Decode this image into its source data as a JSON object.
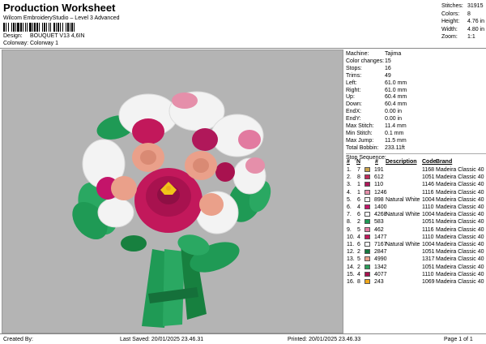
{
  "header": {
    "title": "Production Worksheet",
    "subtitle": "Wilcom EmbroideryStudio – Level 3 Advanced",
    "design_label": "Design:",
    "design_value": "BOUQUET V13 4,6IN",
    "colorway_label": "Colorway:",
    "colorway_value": "Colorway 1",
    "stats": [
      {
        "label": "Stitches:",
        "value": "31915"
      },
      {
        "label": "Colors:",
        "value": "8"
      },
      {
        "label": "Height:",
        "value": "4.76 in"
      },
      {
        "label": "Width:",
        "value": "4.80 in"
      },
      {
        "label": "Zoom:",
        "value": "1:1"
      }
    ]
  },
  "properties": [
    {
      "label": "Machine:",
      "value": "Tajima"
    },
    {
      "label": "Color changes:",
      "value": "15"
    },
    {
      "label": "Stops:",
      "value": "16"
    },
    {
      "label": "Trims:",
      "value": "49"
    },
    {
      "label": "Left:",
      "value": "61.0 mm"
    },
    {
      "label": "Right:",
      "value": "61.0 mm"
    },
    {
      "label": "Up:",
      "value": "60.4 mm"
    },
    {
      "label": "Down:",
      "value": "60.4 mm"
    },
    {
      "label": "EndX:",
      "value": "0.00 in"
    },
    {
      "label": "EndY:",
      "value": "0.00 in"
    },
    {
      "label": "Max Stitch:",
      "value": "11.4 mm"
    },
    {
      "label": "Min Stitch:",
      "value": "0.1 mm"
    },
    {
      "label": "Max Jump:",
      "value": "11.5 mm"
    },
    {
      "label": "Total Bobbin:",
      "value": "233.11ft"
    }
  ],
  "sequence": {
    "title": "Stop Sequence:",
    "headers": {
      "num": "#",
      "n": "N",
      "code_col": "#",
      "description": "Description",
      "code": "Code",
      "brand": "Brand"
    },
    "rows": [
      {
        "num": "1.",
        "n": "7",
        "color": "#c9a24a",
        "code_num": "191",
        "description": "",
        "code": "1168",
        "brand": "Madeira Classic 40"
      },
      {
        "num": "2.",
        "n": "8",
        "color": "#c02a5b",
        "code_num": "612",
        "description": "",
        "code": "1051",
        "brand": "Madeira Classic 40"
      },
      {
        "num": "3.",
        "n": "1",
        "color": "#b0185a",
        "code_num": "110",
        "description": "",
        "code": "1146",
        "brand": "Madeira Classic 40"
      },
      {
        "num": "4.",
        "n": "1",
        "color": "#e58faa",
        "code_num": "1246",
        "description": "",
        "code": "1116",
        "brand": "Madeira Classic 40"
      },
      {
        "num": "5.",
        "n": "6",
        "color": "#f3f3f3",
        "code_num": "898",
        "description": "Natural White",
        "code": "1004",
        "brand": "Madeira Classic 40"
      },
      {
        "num": "6.",
        "n": "4",
        "color": "#c4146a",
        "code_num": "1400",
        "description": "",
        "code": "1110",
        "brand": "Madeira Classic 40"
      },
      {
        "num": "7.",
        "n": "6",
        "color": "#f5f5f5",
        "code_num": "4268",
        "description": "Natural White",
        "code": "1004",
        "brand": "Madeira Classic 40"
      },
      {
        "num": "8.",
        "n": "2",
        "color": "#1f9a55",
        "code_num": "583",
        "description": "",
        "code": "1051",
        "brand": "Madeira Classic 40"
      },
      {
        "num": "9.",
        "n": "5",
        "color": "#e27aa0",
        "code_num": "462",
        "description": "",
        "code": "1116",
        "brand": "Madeira Classic 40"
      },
      {
        "num": "10.",
        "n": "4",
        "color": "#c2185b",
        "code_num": "1477",
        "description": "",
        "code": "1110",
        "brand": "Madeira Classic 40"
      },
      {
        "num": "11.",
        "n": "6",
        "color": "#f7f7f7",
        "code_num": "7167",
        "description": "Natural White",
        "code": "1004",
        "brand": "Madeira Classic 40"
      },
      {
        "num": "12.",
        "n": "2",
        "color": "#157a3f",
        "code_num": "2847",
        "description": "",
        "code": "1051",
        "brand": "Madeira Classic 40"
      },
      {
        "num": "13.",
        "n": "5",
        "color": "#eaa08a",
        "code_num": "4990",
        "description": "",
        "code": "1317",
        "brand": "Madeira Classic 40"
      },
      {
        "num": "14.",
        "n": "2",
        "color": "#2a9e5a",
        "code_num": "1342",
        "description": "",
        "code": "1051",
        "brand": "Madeira Classic 40"
      },
      {
        "num": "15.",
        "n": "4",
        "color": "#a8124f",
        "code_num": "4077",
        "description": "",
        "code": "1110",
        "brand": "Madeira Classic 40"
      },
      {
        "num": "16.",
        "n": "8",
        "color": "#f0a81c",
        "code_num": "243",
        "description": "",
        "code": "1069",
        "brand": "Madeira Classic 40"
      }
    ]
  },
  "footer": {
    "created_by": "Created By:",
    "last_saved": "Last Saved: 20/01/2025 23.46.31",
    "printed": "Printed: 20/01/2025 23.46.33",
    "page": "Page 1 of 1"
  },
  "colors": {
    "canvas_bg": "#b4b4b4",
    "leaf_green": "#1f9a55",
    "rose_magenta": "#c2185b",
    "rose_peach": "#eaa08a",
    "white_flowers": "#f3f3f3",
    "center_yellow": "#f0c419"
  }
}
